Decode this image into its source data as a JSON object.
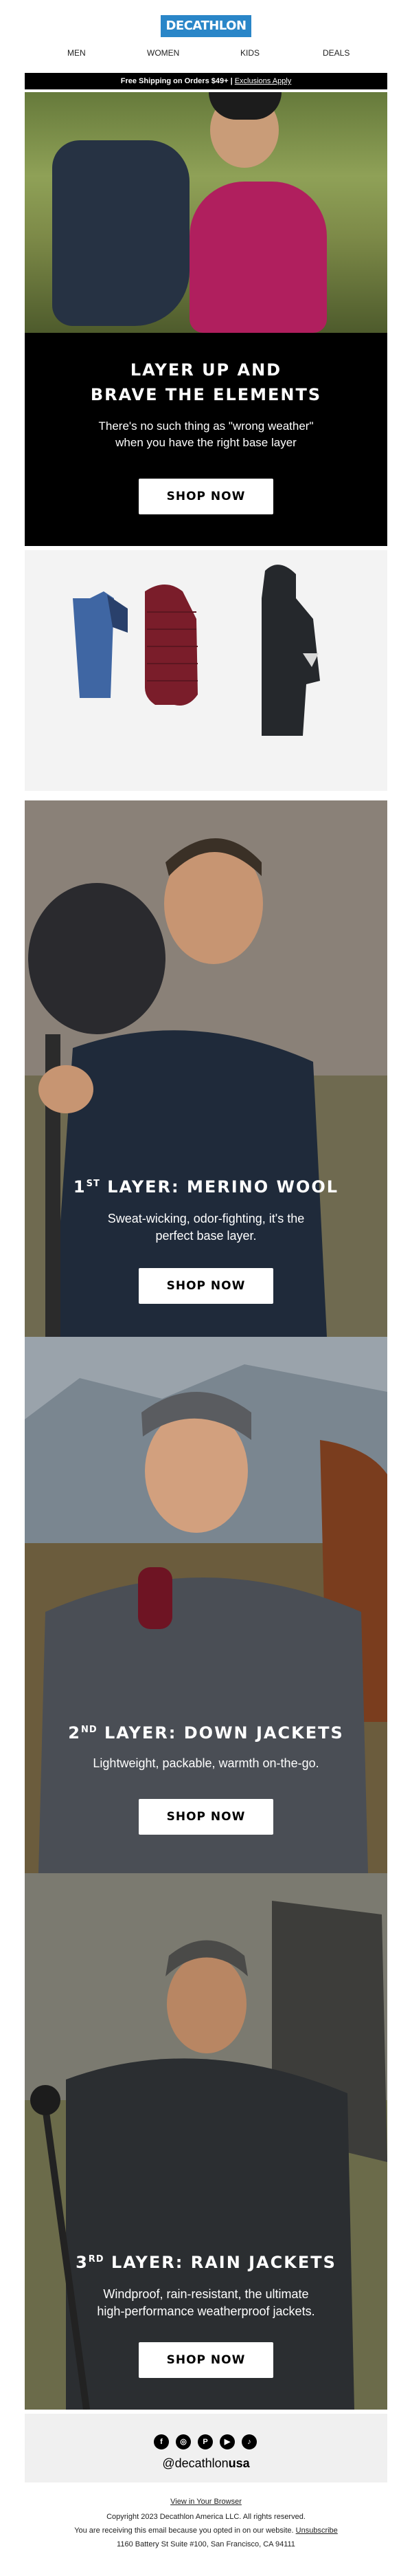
{
  "brand": {
    "logo": "DECATHLON",
    "logo_color": "#2a86c8"
  },
  "nav": [
    "MEN",
    "WOMEN",
    "KIDS",
    "DEALS"
  ],
  "shipping_bar": {
    "text": "Free Shipping on Orders $49+ | ",
    "link": "Exclusions Apply"
  },
  "hero": {
    "title_line1": "LAYER UP AND",
    "title_line2": "BRAVE THE ELEMENTS",
    "desc_line1": "There's no such thing as \"wrong weather\"",
    "desc_line2": "when you have the right base layer",
    "button": "SHOP NOW"
  },
  "products": [
    "merino-tshirt",
    "down-jacket",
    "rain-jacket"
  ],
  "sections": [
    {
      "num": "1",
      "sup": "ST",
      "title": " LAYER: MERINO WOOL",
      "desc_line1": "Sweat-wicking, odor-fighting, it's the",
      "desc_line2": "perfect base layer.",
      "button": "SHOP NOW"
    },
    {
      "num": "2",
      "sup": "ND",
      "title": " LAYER: DOWN JACKETS",
      "desc_line1": "Lightweight, packable, warmth on-the-go.",
      "desc_line2": "",
      "button": "SHOP NOW"
    },
    {
      "num": "3",
      "sup": "RD",
      "title": " LAYER: RAIN JACKETS",
      "desc_line1": "Windproof, rain-resistant, the ultimate",
      "desc_line2": "high-performance weatherproof jackets.",
      "button": "SHOP NOW"
    }
  ],
  "footer": {
    "social_icons": [
      "facebook-icon",
      "instagram-icon",
      "pinterest-icon",
      "youtube-icon",
      "tiktok-icon"
    ],
    "handle_prefix": "@decathlon",
    "handle_suffix": "usa",
    "view_in_browser": "View in Your Browser",
    "copyright": "Copyright 2023 Decathlon America LLC. All rights reserved.",
    "optin_text": "You are receiving this email because you opted in on our website. ",
    "unsubscribe": "Unsubscribe",
    "address": "1160 Battery St Suite #100, San Francisco, CA 94111"
  }
}
